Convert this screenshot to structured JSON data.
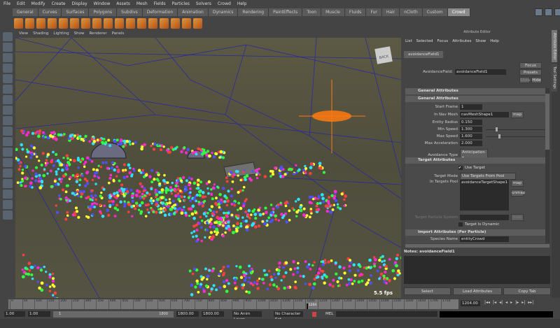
{
  "menu": [
    "File",
    "Edit",
    "Modify",
    "Create",
    "Display",
    "Window",
    "Assets",
    "Mesh",
    "Fields",
    "Particles",
    "Solvers",
    "Crowd",
    "Help"
  ],
  "shelf_tabs": [
    "General",
    "Curves",
    "Surfaces",
    "Polygons",
    "Subdivs",
    "Deformation",
    "Animation",
    "Dynamics",
    "Rendering",
    "PaintEffects",
    "Toon",
    "Muscle",
    "Fluids",
    "Fur",
    "Hair",
    "nCloth",
    "Custom",
    "Crowd"
  ],
  "active_shelf": "Crowd",
  "panel_menu": [
    "View",
    "Shading",
    "Lighting",
    "Show",
    "Renderer",
    "Panels"
  ],
  "viewport": {
    "fps": "5.5 fps",
    "viewcube_label": "BACK"
  },
  "attr_editor": {
    "title": "Attribute Editor",
    "menu": [
      "List",
      "Selected",
      "Focus",
      "Attributes",
      "Show",
      "Help"
    ],
    "tab": "avoidanceField1",
    "node_label": "AvoidanceField:",
    "node_value": "avoidanceField1",
    "focus": "Focus",
    "presets": "Presets",
    "show": "Show",
    "hide": "Hide",
    "sec_general_outer": "General Attributes",
    "sec_general": "General Attributes",
    "start_frame_label": "Start Frame",
    "start_frame": "1",
    "nav_mesh_label": "In Nav Mesh",
    "nav_mesh": "navMeshShape1",
    "map": "map",
    "entity_radius_label": "Entity Radius",
    "entity_radius": "0.150",
    "min_speed_label": "Min Speed",
    "min_speed": "1.300",
    "max_speed_label": "Max Speed",
    "max_speed": "1.600",
    "max_accel_label": "Max Acceleration",
    "max_accel": "2.000",
    "avoid_type_label": "Avoidance Type",
    "avoid_type": "Anticipation",
    "sec_target": "Target Attributes",
    "use_target": "Use Target",
    "target_mode_label": "Target Mode",
    "target_mode": "Use Targets From Pool",
    "targets_pool_label": "In Targets Pool",
    "targets_pool": "avoidanceTargetShape1",
    "unmap": "unmap",
    "target_particle_label": "Target Particle System",
    "target_dynamic": "Target Is Dynamic",
    "sec_import": "Import Attributes (Per Particle)",
    "species_label": "Species Name",
    "species_value": "entityCrowd",
    "notes": "Notes: avoidanceField1",
    "select": "Select",
    "load": "Load Attributes",
    "copy": "Copy Tab"
  },
  "side_tabs": [
    "Attribute Editor",
    "Tool Settings"
  ],
  "timeline": {
    "ticks": [
      "0",
      "50",
      "100",
      "150",
      "200",
      "250",
      "300",
      "350",
      "400",
      "450",
      "500",
      "550",
      "600",
      "650",
      "700",
      "750",
      "800",
      "850",
      "900",
      "950",
      "1000",
      "1050",
      "1100",
      "1150",
      "1200",
      "1250",
      "1300",
      "1350",
      "1400",
      "1450",
      "1500",
      "1550",
      "1600",
      "1650",
      "1700",
      "1750"
    ],
    "current": "1204",
    "current_field": "1204.00"
  },
  "range": {
    "start": "1.00",
    "start2": "1.00",
    "slider_start": "1",
    "slider_end": "1800",
    "end": "1800.00",
    "end2": "1800.00",
    "anim_layer": "No Anim Layer",
    "char_set": "No Character Set",
    "mel": "MEL"
  }
}
